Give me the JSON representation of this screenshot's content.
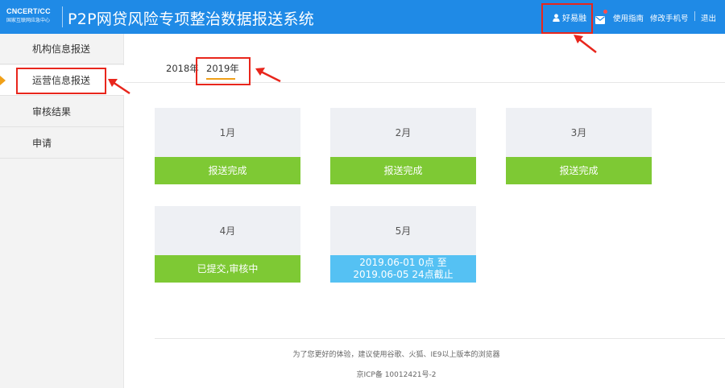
{
  "header": {
    "logo_main": "CNCERT/CC",
    "logo_sub": "国家互联网应急中心",
    "title": "P2P网贷风险专项整治数据报送系统",
    "user_name": "好易融",
    "links": {
      "guide": "使用指南",
      "change_phone": "修改手机号",
      "logout": "退出"
    }
  },
  "sidebar": {
    "items": [
      {
        "label": "机构信息报送"
      },
      {
        "label": "运营信息报送"
      },
      {
        "label": "审核结果"
      },
      {
        "label": "申请"
      }
    ],
    "active_index": 1
  },
  "tabs": [
    {
      "label": "2018年"
    },
    {
      "label": "2019年"
    }
  ],
  "active_tab": "2019年",
  "months": [
    {
      "month": "1月",
      "status": "报送完成",
      "state": "done"
    },
    {
      "month": "2月",
      "status": "报送完成",
      "state": "done"
    },
    {
      "month": "3月",
      "status": "报送完成",
      "state": "done"
    },
    {
      "month": "4月",
      "status": "已提交,审核中",
      "state": "review"
    },
    {
      "month": "5月",
      "status": "2019.06-01 0点 至\n2019.06-05 24点截止",
      "state": "pending"
    }
  ],
  "footer": {
    "browser_note": "为了您更好的体验，建议使用谷歌、火狐、IE9以上版本的浏览器",
    "icp": "京ICP备 10012421号-2"
  },
  "colors": {
    "header_bg": "#1f8ae6",
    "done": "#7ec934",
    "pending": "#55c1f3",
    "accent": "#f0a018",
    "annotation": "#e8261c"
  }
}
